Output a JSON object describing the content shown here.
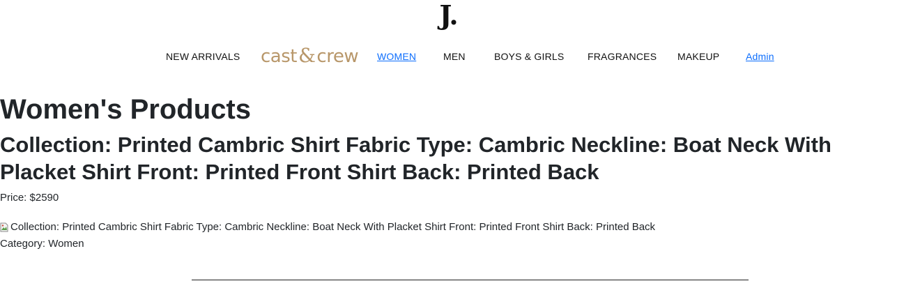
{
  "header": {
    "logo_text": "J."
  },
  "nav": {
    "items": [
      {
        "label": "NEW ARRIVALS"
      },
      {
        "label": "WOMEN"
      },
      {
        "label": "MEN"
      },
      {
        "label": "BOYS & GIRLS"
      },
      {
        "label": "FRAGRANCES"
      },
      {
        "label": "MAKEUP"
      },
      {
        "label": "Admin"
      }
    ],
    "brand_logo": {
      "left_word": "cast",
      "ampersand": "&",
      "right_word": "crew"
    }
  },
  "main": {
    "page_title": "Women's Products",
    "product": {
      "title": "Collection: Printed Cambric Shirt Fabric Type: Cambric Neckline: Boat Neck With Placket Shirt Front: Printed Front Shirt Back: Printed Back",
      "price_label": "Price: $2590",
      "image_alt": "Collection: Printed Cambric Shirt Fabric Type: Cambric Neckline: Boat Neck With Placket Shirt Front: Printed Front Shirt Back: Printed Back",
      "category_label": "Category: Women"
    }
  },
  "colors": {
    "text": "#212529",
    "link": "#0d6efd",
    "brand_gold": "#b8976a"
  }
}
